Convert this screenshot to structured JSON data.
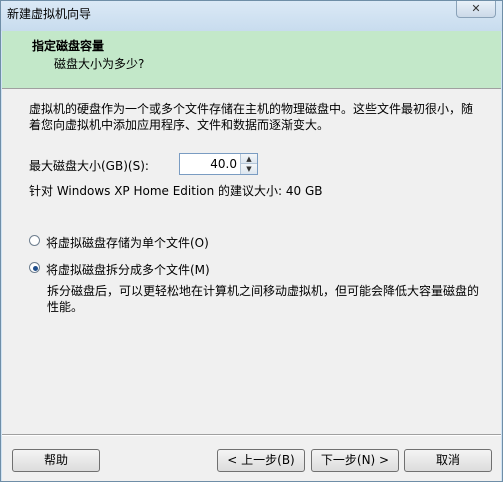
{
  "window": {
    "title": "新建虚拟机向导",
    "close_label": "✕"
  },
  "banner": {
    "title": "指定磁盘容量",
    "subtitle": "磁盘大小为多少?"
  },
  "main": {
    "description": "虚拟机的硬盘作为一个或多个文件存储在主机的物理磁盘中。这些文件最初很小，随着您向虚拟机中添加应用程序、文件和数据而逐渐变大。",
    "size_label": "最大磁盘大小(GB)(S):",
    "size_value": "40.0",
    "recommendation": "针对 Windows XP Home Edition 的建议大小: 40 GB",
    "options": [
      {
        "label": "将虚拟磁盘存储为单个文件(O)",
        "selected": false
      },
      {
        "label": "将虚拟磁盘拆分成多个文件(M)",
        "selected": true
      }
    ],
    "split_description": "拆分磁盘后，可以更轻松地在计算机之间移动虚拟机，但可能会降低大容量磁盘的性能。"
  },
  "footer": {
    "help_label": "帮助",
    "back_label": "< 上一步(B)",
    "next_label": "下一步(N) >",
    "cancel_label": "取消"
  },
  "icons": {
    "spin_up": "spin-up-icon",
    "spin_down": "spin-down-icon",
    "close": "close-icon"
  }
}
